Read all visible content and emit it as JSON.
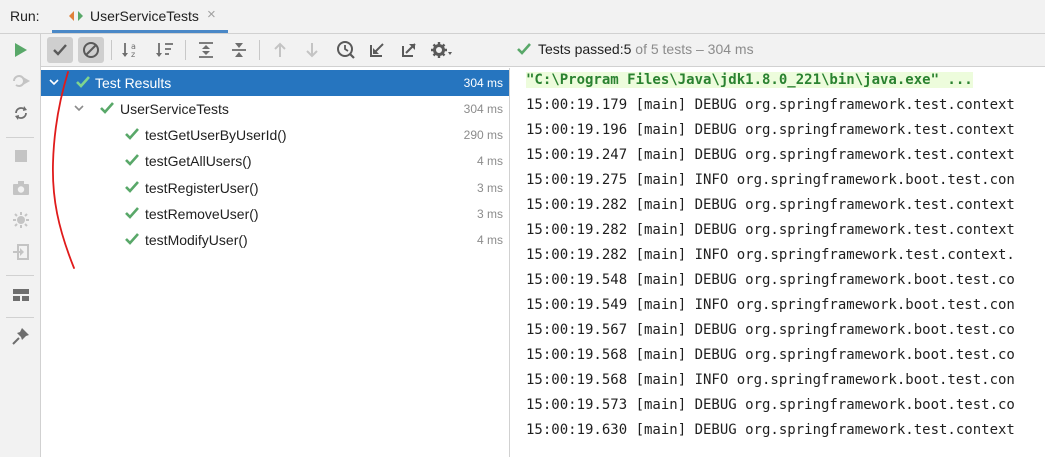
{
  "tabbar": {
    "run_label": "Run:",
    "tab_title": "UserServiceTests",
    "close_glyph": "×"
  },
  "left_toolbar": {
    "icons": [
      "rerun-icon",
      "rerun-failed-icon",
      "toggle-auto-test-icon",
      "stop-icon",
      "screenshot-icon",
      "export-icon",
      "exit-icon",
      "layout-icon",
      "pin-icon"
    ]
  },
  "test_toolbar": {
    "icons": [
      "show-passed-icon",
      "show-ignored-icon",
      "sort-alpha-icon",
      "sort-duration-icon",
      "expand-all-icon",
      "collapse-all-icon",
      "previous-failed-icon",
      "next-failed-icon",
      "history-icon",
      "import-icon",
      "export-results-icon",
      "settings-icon"
    ],
    "status_prefix": "Tests passed: ",
    "status_passed": "5",
    "status_rest": " of 5 tests – 304 ms"
  },
  "tree": {
    "root": {
      "label": "Test Results",
      "time": "304 ms"
    },
    "suite": {
      "label": "UserServiceTests",
      "time": "304 ms"
    },
    "tests": [
      {
        "label": "testGetUserByUserId()",
        "time": "290 ms"
      },
      {
        "label": "testGetAllUsers()",
        "time": "4 ms"
      },
      {
        "label": "testRegisterUser()",
        "time": "3 ms"
      },
      {
        "label": "testRemoveUser()",
        "time": "3 ms"
      },
      {
        "label": "testModifyUser()",
        "time": "4 ms"
      }
    ]
  },
  "console": {
    "command": "\"C:\\Program Files\\Java\\jdk1.8.0_221\\bin\\java.exe\" ...",
    "lines": [
      "15:00:19.179 [main] DEBUG org.springframework.test.context",
      "15:00:19.196 [main] DEBUG org.springframework.test.context",
      "15:00:19.247 [main] DEBUG org.springframework.test.context",
      "15:00:19.275 [main] INFO org.springframework.boot.test.con",
      "15:00:19.282 [main] DEBUG org.springframework.test.context",
      "15:00:19.282 [main] DEBUG org.springframework.test.context",
      "15:00:19.282 [main] INFO org.springframework.test.context.",
      "15:00:19.548 [main] DEBUG org.springframework.boot.test.co",
      "15:00:19.549 [main] INFO org.springframework.boot.test.con",
      "15:00:19.567 [main] DEBUG org.springframework.boot.test.co",
      "15:00:19.568 [main] DEBUG org.springframework.boot.test.co",
      "15:00:19.568 [main] INFO org.springframework.boot.test.con",
      "15:00:19.573 [main] DEBUG org.springframework.boot.test.co",
      "15:00:19.630 [main] DEBUG org.springframework.test.context"
    ]
  },
  "colors": {
    "accent": "#2675bf",
    "pass_green": "#59a869",
    "command_green": "#2a8230",
    "annotation_red": "#e01b1b"
  }
}
